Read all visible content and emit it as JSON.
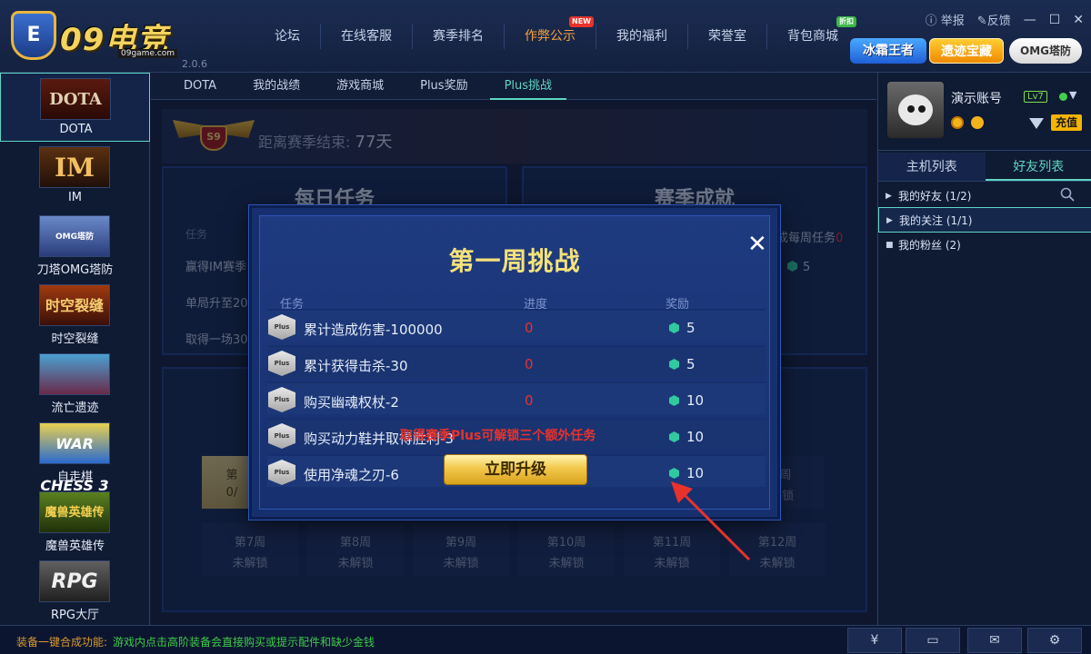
{
  "app": {
    "brand": "09电竞",
    "site": "09game.com",
    "version": "2.0.6"
  },
  "nav": [
    {
      "label": "论坛",
      "badge": ""
    },
    {
      "label": "在线客服",
      "badge": ""
    },
    {
      "label": "赛季排名",
      "badge": ""
    },
    {
      "label": "作弊公示",
      "badge": "NEW"
    },
    {
      "label": "我的福利",
      "badge": ""
    },
    {
      "label": "荣誉室",
      "badge": ""
    },
    {
      "label": "背包商城",
      "badge": "折扣"
    }
  ],
  "window": {
    "report": "举报",
    "feedback": "反馈",
    "minimize": "—",
    "maximize": "☐",
    "close": "✕"
  },
  "promos": {
    "ice": "冰霜王者",
    "relic": "遗迹宝藏",
    "omg": "OMG塔防"
  },
  "games": [
    {
      "label": "DOTA",
      "thumb": "DOTA"
    },
    {
      "label": "IM",
      "thumb": "IM"
    },
    {
      "label": "刀塔OMG塔防",
      "thumb": "OMG塔防"
    },
    {
      "label": "时空裂缝",
      "thumb": "时空裂缝"
    },
    {
      "label": "流亡遗迹",
      "thumb": ""
    },
    {
      "label": "自走棋",
      "thumb": "WAR CHESS 3"
    },
    {
      "label": "魔兽英雄传",
      "thumb": "魔兽英雄传"
    },
    {
      "label": "RPG大厅",
      "thumb": "RPG"
    }
  ],
  "tabs": [
    "DOTA",
    "我的战绩",
    "游戏商城",
    "Plus奖励",
    "Plus挑战"
  ],
  "season": {
    "badge": "S9",
    "label": "距离赛季结束:",
    "days": "77天"
  },
  "daily": {
    "title": "每日任务",
    "header": "任务",
    "rows": [
      "赢得IM赛季",
      "单局升至20",
      "取得一场30"
    ]
  },
  "achievement": {
    "title": "赛季成就",
    "mission": "成每周任务",
    "mission_count": "0",
    "reward": "5"
  },
  "weeks": [
    {
      "week": "第",
      "status": "0/"
    },
    {
      "week": "5周",
      "status": "解锁"
    },
    {
      "week": "第7周",
      "status": "未解锁"
    },
    {
      "week": "第8周",
      "status": "未解锁"
    },
    {
      "week": "第9周",
      "status": "未解锁"
    },
    {
      "week": "第10周",
      "status": "未解锁"
    },
    {
      "week": "第11周",
      "status": "未解锁"
    },
    {
      "week": "第12周",
      "status": "未解锁"
    }
  ],
  "profile": {
    "username": "演示账号",
    "level": "Lv7",
    "recharge": "充值"
  },
  "right_tabs": [
    "主机列表",
    "好友列表"
  ],
  "friends": [
    {
      "label": "我的好友 (1/2)"
    },
    {
      "label": "我的关注 (1/1)"
    },
    {
      "label": "我的粉丝 (2)"
    }
  ],
  "bottom": {
    "tip_label": "装备一键合成功能:",
    "tip_text": "游戏内点击高阶装备会直接购买或提示配件和缺少金钱"
  },
  "modal": {
    "title": "第一周挑战",
    "close": "✕",
    "headers": {
      "task": "任务",
      "progress": "进度",
      "reward": "奖励"
    },
    "icon_text": "Plus",
    "rows": [
      {
        "task": "累计造成伤害-100000",
        "progress": "0",
        "reward": "5"
      },
      {
        "task": "累计获得击杀-30",
        "progress": "0",
        "reward": "5"
      },
      {
        "task": "购买幽魂权杖-2",
        "progress": "0",
        "reward": "10"
      },
      {
        "task": "购买动力鞋并取得胜利-3",
        "progress": "",
        "reward": "10"
      },
      {
        "task": "使用净魂之刃-6",
        "progress": "",
        "reward": "10"
      }
    ],
    "note": "取得赛季Plus可解锁三个额外任务",
    "upgrade": "立即升级"
  }
}
